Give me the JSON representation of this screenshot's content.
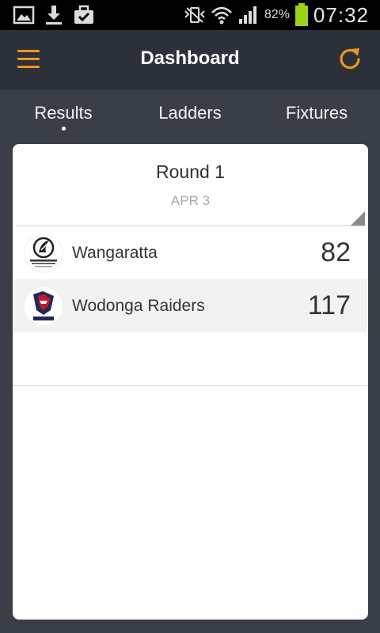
{
  "status_bar": {
    "battery_percent": "82%",
    "time": "07:32",
    "icons": [
      "image-icon",
      "download-icon",
      "briefcase-icon",
      "vibrate-icon",
      "wifi-icon",
      "signal-icon",
      "battery-icon"
    ]
  },
  "header": {
    "title": "Dashboard",
    "menu_icon": "hamburger-icon",
    "refresh_icon": "refresh-icon",
    "accent_color": "#f0931e"
  },
  "tabs": [
    {
      "label": "Results",
      "active": true
    },
    {
      "label": "Ladders",
      "active": false
    },
    {
      "label": "Fixtures",
      "active": false
    }
  ],
  "round": {
    "title": "Round 1",
    "date": "APR 3"
  },
  "matches": [
    {
      "teams": [
        {
          "name": "Wangaratta",
          "score": "82",
          "logo": "wangaratta-logo"
        },
        {
          "name": "Wodonga Raiders",
          "score": "117",
          "logo": "wodonga-raiders-logo"
        }
      ]
    }
  ]
}
